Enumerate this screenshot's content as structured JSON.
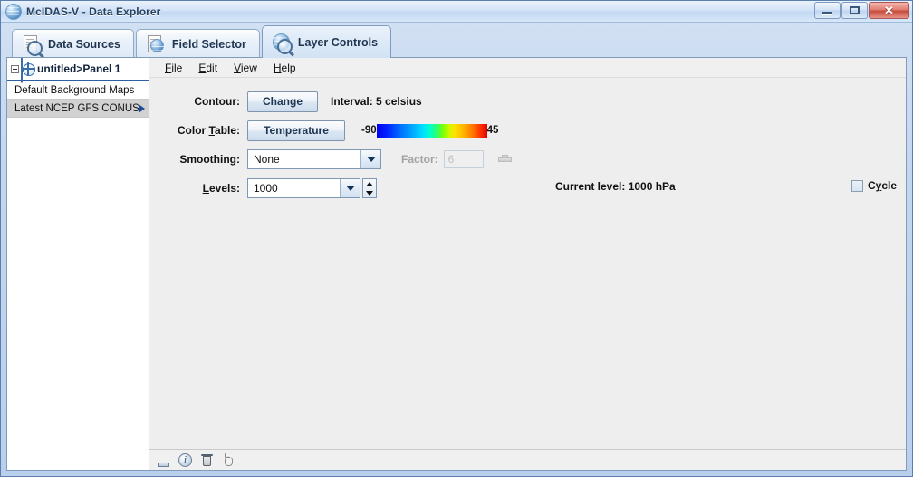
{
  "window": {
    "title": "McIDAS-V - Data Explorer",
    "icon": "mcidas-globe-icon",
    "buttons": {
      "minimize": "minimize-button",
      "maximize": "maximize-button",
      "close": "✕"
    }
  },
  "tabs": [
    {
      "label": "Data Sources",
      "icon": "document-magnifier-icon",
      "active": false
    },
    {
      "label": "Field Selector",
      "icon": "globe-document-magnifier-icon",
      "active": false
    },
    {
      "label": "Layer Controls",
      "icon": "globe-magnifier-icon",
      "active": true
    }
  ],
  "tree": {
    "root_label": "untitled>Panel 1",
    "items": [
      {
        "label": "Default Background Maps",
        "selected": false,
        "has_arrow": false
      },
      {
        "label": "Latest NCEP GFS CONUS.",
        "selected": true,
        "has_arrow": true
      }
    ]
  },
  "menubar": [
    {
      "mnemonic": "F",
      "rest": "ile"
    },
    {
      "mnemonic": "E",
      "rest": "dit"
    },
    {
      "mnemonic": "V",
      "rest": "iew"
    },
    {
      "mnemonic": "H",
      "rest": "elp"
    }
  ],
  "form": {
    "contour": {
      "label": "Contour:",
      "button": "Change",
      "interval_text": "Interval: 5 celsius"
    },
    "color_table": {
      "label_pre": "Color ",
      "label_mnemonic": "T",
      "label_post": "able:",
      "button": "Temperature",
      "min": "-90",
      "max": "45",
      "gradient_name": "temperature-color-table"
    },
    "smoothing": {
      "label": "Smoothing:",
      "value": "None",
      "factor_label": "Factor:",
      "factor_value": "6",
      "factor_enabled": false
    },
    "levels": {
      "label_mnemonic": "L",
      "label_rest": "evels:",
      "value": "1000",
      "current_level_text": "Current level: 1000 hPa",
      "cycle_pre": "C",
      "cycle_mnemonic": "y",
      "cycle_post": "cle",
      "cycle_checked": false
    }
  },
  "bottom_toolbar": [
    {
      "icon": "export-icon"
    },
    {
      "icon": "info-icon"
    },
    {
      "icon": "trash-icon"
    },
    {
      "icon": "hand-pan-icon"
    }
  ],
  "colors": {
    "accent": "#2e5fa3",
    "panel_bg": "#eeeeee",
    "window_chrome": "#c3d6ef"
  }
}
